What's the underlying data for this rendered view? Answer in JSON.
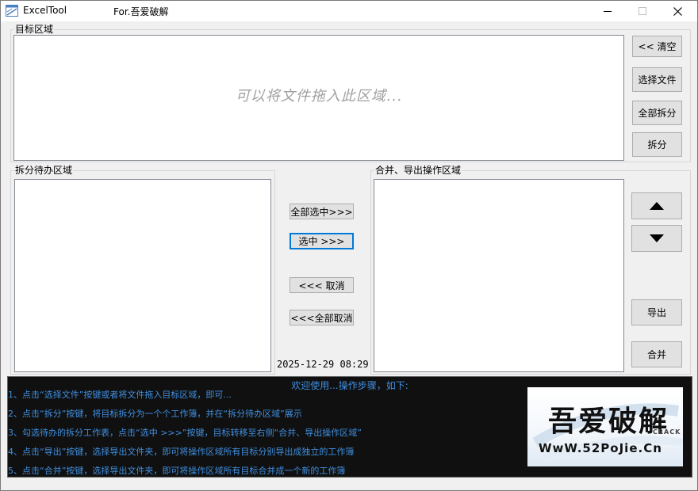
{
  "window": {
    "app_title": "ExcelTool",
    "sub_title": "For.吾爱破解"
  },
  "target_area": {
    "label": "目标区域",
    "drop_hint": "可以将文件拖入此区域..."
  },
  "buttons": {
    "clear": "<< 清空",
    "select_file": "选择文件",
    "split_all": "全部拆分",
    "split": "拆分",
    "select_all": "全部选中>>>",
    "select": "选中 >>>",
    "cancel": "<<< 取消",
    "cancel_all": "<<<全部取消",
    "export": "导出",
    "merge": "合并"
  },
  "pending_area": {
    "label": "拆分待办区域"
  },
  "operation_area": {
    "label": "合并、导出操作区域"
  },
  "datetime": "2025-12-29 08:29",
  "console": {
    "title": "欢迎使用...操作步骤，如下:",
    "steps": [
      "1、点击“选择文件”按键或者将文件拖入目标区域，即可...",
      "2、点击“拆分”按键，将目标拆分为一个个工作簿，并在“拆分待办区域”展示",
      "3、勾选待办的拆分工作表，点击“选中 >>>”按键，目标转移至右侧“合并、导出操作区域”",
      "4、点击“导出”按键，选择导出文件夹，即可将操作区域所有目标分别导出成独立的工作簿",
      "5、点击“合并”按键，选择导出文件夹，即可将操作区域所有目标合并成一个新的工作簿"
    ]
  },
  "logo": {
    "main": "吾爱破解",
    "crack": "CRACK",
    "url": "WwW.52PoJie.Cn"
  },
  "colors": {
    "console_bg": "#101010",
    "console_text": "#3f8fe0",
    "focus_border": "#0078d7"
  }
}
